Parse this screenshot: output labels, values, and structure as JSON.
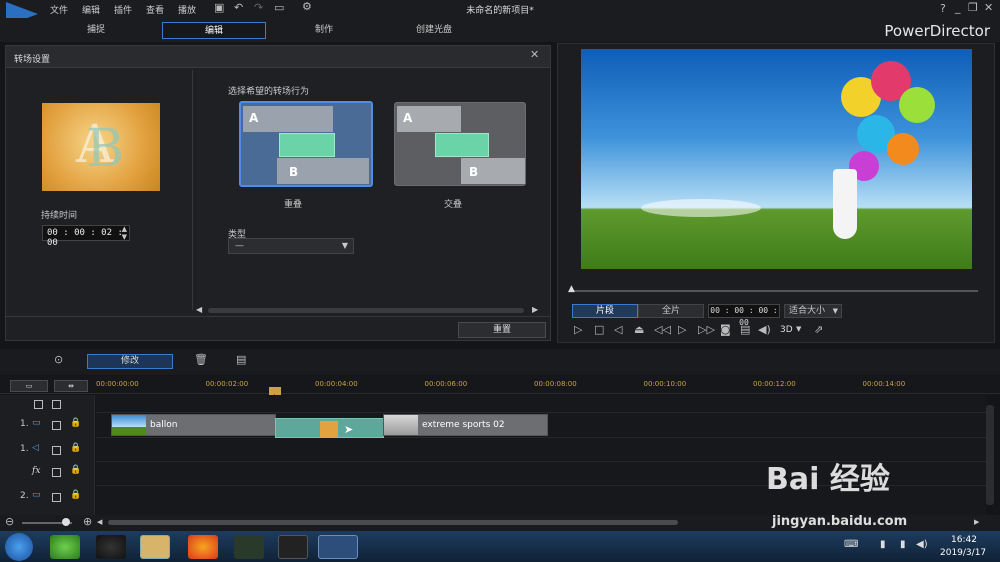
{
  "app": {
    "title": "未命名的新项目*",
    "brand": "PowerDirector",
    "help": "?"
  },
  "menu": [
    "文件",
    "编辑",
    "插件",
    "查看",
    "播放"
  ],
  "modes": [
    {
      "label": "捕捉"
    },
    {
      "label": "编辑",
      "active": true
    },
    {
      "label": "制作"
    },
    {
      "label": "创建光盘"
    }
  ],
  "transition_panel": {
    "title": "转场设置",
    "duration_label": "持续时间",
    "duration_value": "00 : 00 : 02 : 00",
    "behavior_label": "选择希望的转场行为",
    "options": [
      {
        "label": "重叠",
        "selected": true
      },
      {
        "label": "交叠",
        "selected": false
      }
    ],
    "letter_a": "A",
    "letter_b": "B",
    "type_label": "类型",
    "type_value": "—",
    "reset_button": "重置"
  },
  "preview": {
    "tab_clip": "片段",
    "tab_full": "全片",
    "timecode": "00 : 00 : 00 : 00",
    "fit": "适合大小",
    "mode3d": "3D"
  },
  "toolbar": {
    "modify": "修改"
  },
  "ruler": [
    "00:00:00:00",
    "00:00:02:00",
    "00:00:04:00",
    "00:00:06:00",
    "00:00:08:00",
    "00:00:10:00",
    "00:00:12:00",
    "00:00:14:00"
  ],
  "tracks": [
    {
      "label": "1."
    },
    {
      "label": "1."
    },
    {
      "label": "fx"
    },
    {
      "label": "2."
    }
  ],
  "clips": [
    {
      "name": "ballon"
    },
    {
      "name": "extreme sports 02"
    }
  ],
  "taskbar": {
    "time": "16:42",
    "date": "2019/3/17"
  },
  "watermark": {
    "logo": "Bai 经验",
    "url": "jingyan.baidu.com"
  },
  "colors": {
    "accent": "#3a7ad0",
    "ruler_text": "#c9a24a",
    "playhead": "#d83030",
    "transition": "#5db89a"
  }
}
